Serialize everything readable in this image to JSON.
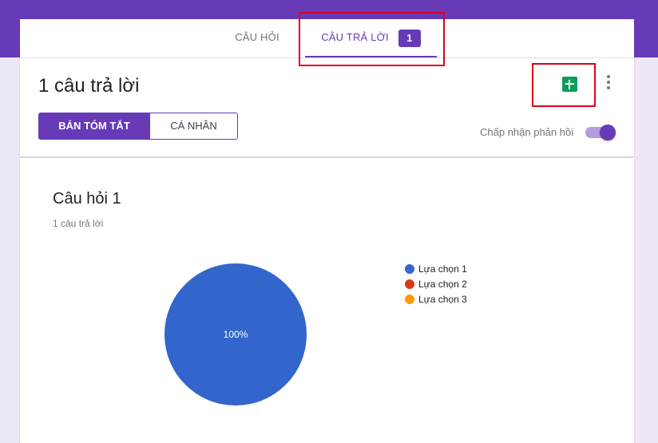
{
  "tabs": {
    "questions_label": "CÂU HỎI",
    "responses_label": "CÂU TRẢ LỜI",
    "responses_badge": "1"
  },
  "summary": {
    "count_title": "1 câu trả lời",
    "view_summary_label": "BẢN TÓM TẮT",
    "view_individual_label": "CÁ NHÂN",
    "accept_responses_label": "Chấp nhận phản hồi",
    "accept_responses_on": true
  },
  "icons": {
    "sheets": "google-sheets-icon",
    "more": "more-vert-icon"
  },
  "colors": {
    "accent": "#673ab7",
    "sheets": "#0f9d58",
    "highlight": "#e0001b"
  },
  "question": {
    "title": "Câu hỏi 1",
    "response_count": "1 câu trả lời"
  },
  "chart_data": {
    "type": "pie",
    "title": "",
    "slices": [
      {
        "name": "Lựa chọn 1",
        "value": 1,
        "percent_label": "100%",
        "color": "#3366cc"
      },
      {
        "name": "Lựa chọn 2",
        "value": 0,
        "percent_label": "",
        "color": "#dc3912"
      },
      {
        "name": "Lựa chọn 3",
        "value": 0,
        "percent_label": "",
        "color": "#ff9900"
      }
    ],
    "legend": "right"
  }
}
